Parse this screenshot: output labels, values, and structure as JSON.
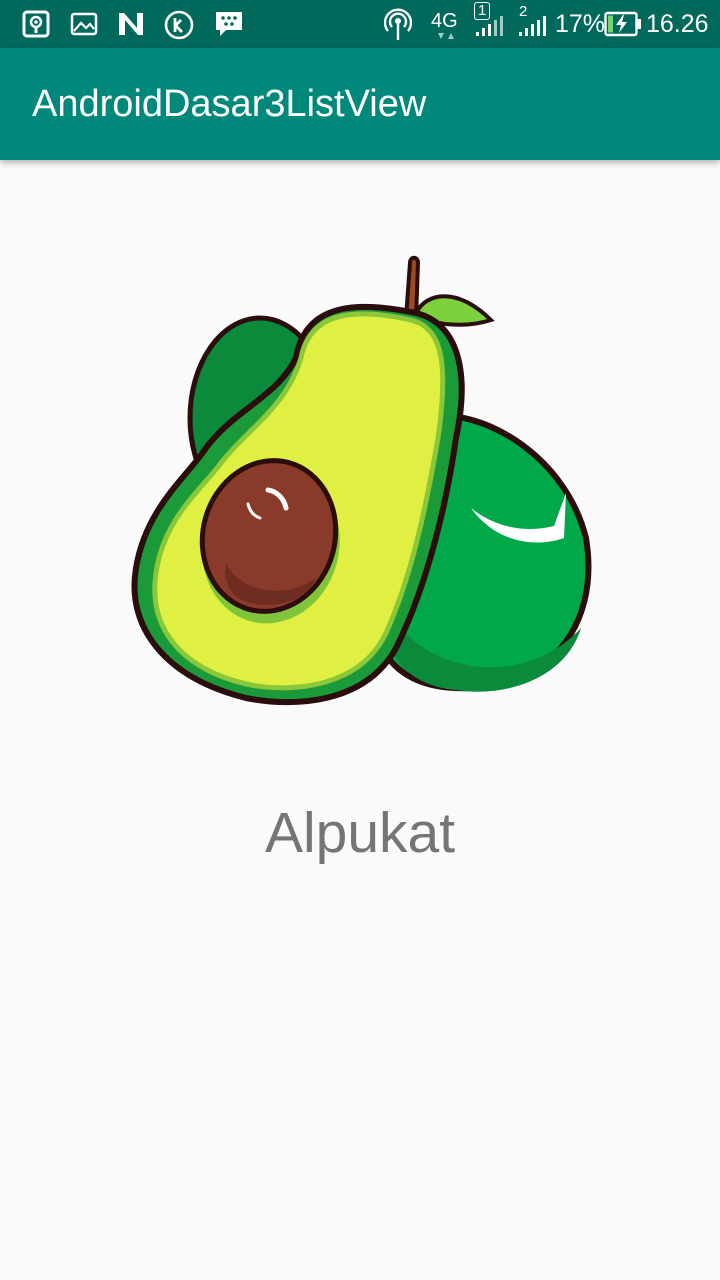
{
  "status_bar": {
    "left_icons": [
      "podcast-icon",
      "image-icon",
      "n-notification-icon",
      "kik-icon",
      "bbm-icon"
    ],
    "right_icons": [
      "hotspot-icon",
      "signal-sim1-icon",
      "signal-sim2-icon",
      "battery-charging-icon"
    ],
    "network": "4G",
    "sim1": "1",
    "sim2": "2",
    "battery": "17%",
    "time": "16.26"
  },
  "app_bar": {
    "title": "AndroidDasar3ListView"
  },
  "detail": {
    "image": "avocado-image",
    "name": "Alpukat"
  },
  "colors": {
    "status_bar": "#00695c",
    "app_bar": "#00897b",
    "background": "#fafafa",
    "text_secondary": "#757575"
  }
}
